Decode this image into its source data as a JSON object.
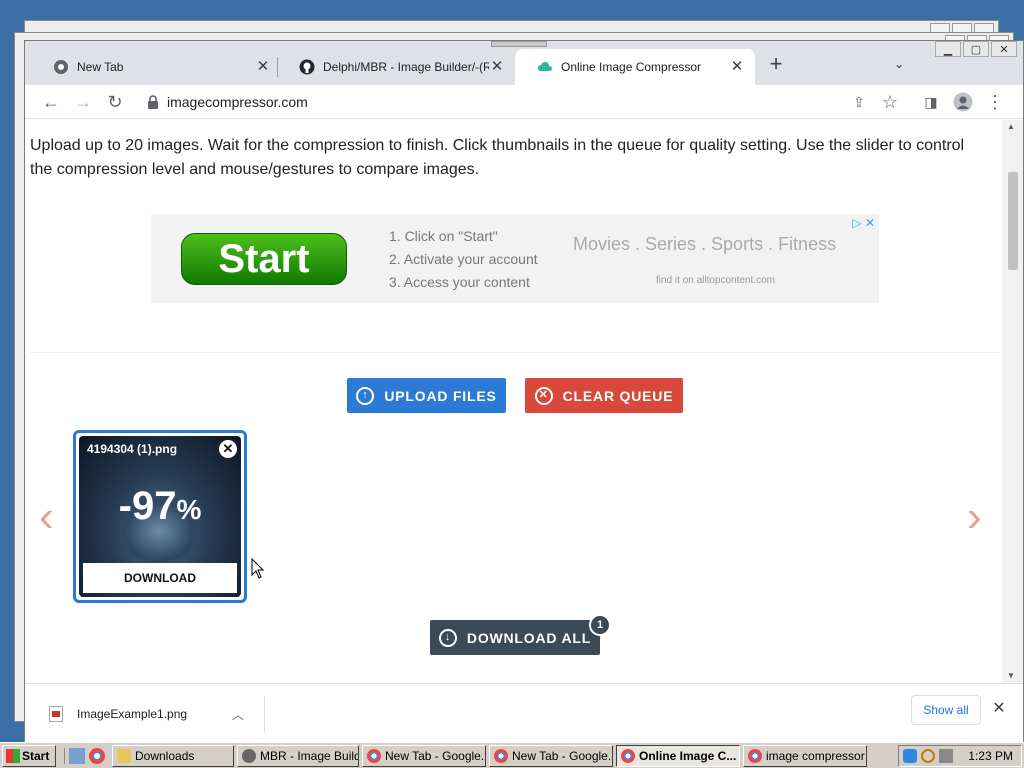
{
  "tabs": [
    {
      "title": "New Tab",
      "icon": "chrome-icon"
    },
    {
      "title": "Delphi/MBR - Image Builder/-(RES)-/(",
      "icon": "github-icon"
    },
    {
      "title": "Online Image Compressor",
      "icon": "cloud-icon"
    }
  ],
  "address": {
    "url": "imagecompressor.com"
  },
  "page": {
    "intro": "Upload up to 20 images. Wait for the compression to finish. Click thumbnails in the queue for quality setting. Use the slider to control the compression level and mouse/gestures to compare images.",
    "ad": {
      "start_label": "Start",
      "steps": [
        "1. Click on \"Start\"",
        "2. Activate your account",
        "3. Access your content"
      ],
      "categories": "Movies . Series . Sports . Fitness",
      "footer": "find it on alltopcontent.com",
      "choices": "▷ ✕"
    },
    "upload_label": "UPLOAD FILES",
    "clear_label": "CLEAR QUEUE",
    "thumbnail": {
      "filename": "4194304 (1).png",
      "savings": "-97",
      "savings_unit": "%",
      "download_label": "DOWNLOAD"
    },
    "download_all_label": "DOWNLOAD ALL",
    "download_count": "1"
  },
  "download_bar": {
    "filename": "ImageExample1.png",
    "show_all": "Show all"
  },
  "taskbar": {
    "start_label": "Start",
    "tasks": [
      {
        "label": "Downloads"
      },
      {
        "label": "MBR - Image Builder"
      },
      {
        "label": "New Tab - Google..."
      },
      {
        "label": "New Tab - Google..."
      },
      {
        "label": "Online Image C..."
      },
      {
        "label": "image compressor -..."
      }
    ],
    "clock": "1:23 PM"
  },
  "colors": {
    "upload": "#2b7bd6",
    "clear": "#d8493b",
    "download_all": "#3c4a57",
    "ad_start": "#2ea80a"
  }
}
